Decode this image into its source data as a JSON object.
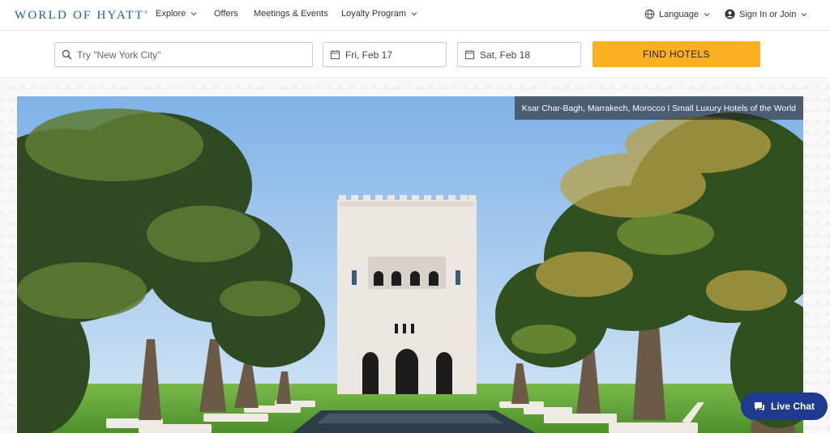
{
  "brand": {
    "logo_text": "WORLD OF HYATT",
    "registered_mark": "®",
    "color": "#1f5fa6"
  },
  "nav": {
    "explore": "Explore",
    "offers": "Offers",
    "meetings": "Meetings & Events",
    "loyalty": "Loyalty Program",
    "language": "Language",
    "signin": "Sign In or Join"
  },
  "search": {
    "destination_placeholder": "Try \"New York City\"",
    "checkin": "Fri, Feb 17",
    "checkout": "Sat, Feb 18",
    "button_label": "FIND HOTELS",
    "button_color": "#fbb021"
  },
  "hero": {
    "caption": "Ksar Char-Bagh, Marrakech, Morocco I Small Luxury Hotels of the World"
  },
  "chat": {
    "label": "Live Chat",
    "color": "#1f3a8f"
  },
  "icons": [
    "chevron-down-icon",
    "globe-icon",
    "user-icon",
    "search-icon",
    "calendar-icon",
    "chat-icon"
  ]
}
